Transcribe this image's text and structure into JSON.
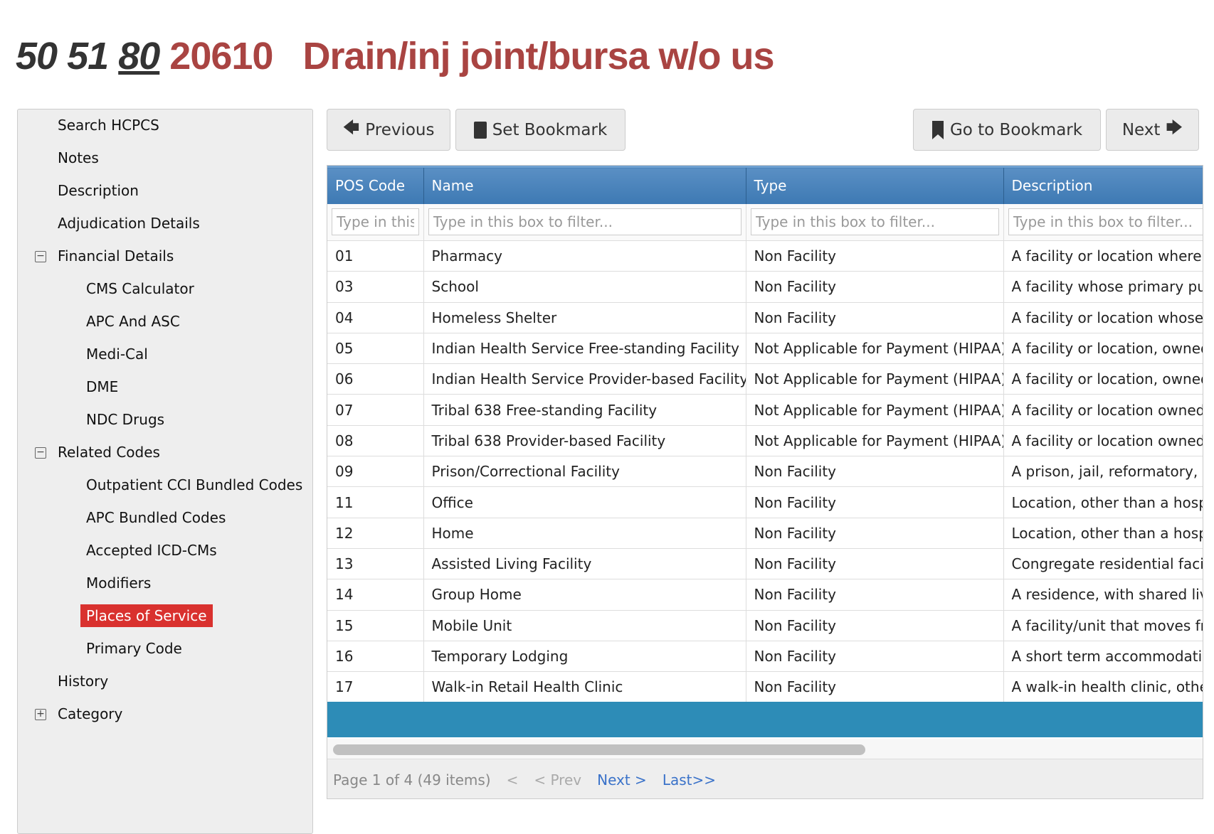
{
  "header": {
    "modifiers": [
      "50",
      "51"
    ],
    "modifier_underlined": "80",
    "code": "20610",
    "title": "Drain/inj joint/bursa w/o us"
  },
  "sidebar": {
    "items": [
      {
        "label": "Search HCPCS",
        "level": 1
      },
      {
        "label": "Notes",
        "level": 1
      },
      {
        "label": "Description",
        "level": 1
      },
      {
        "label": "Adjudication Details",
        "level": 1
      },
      {
        "label": "Financial Details",
        "level": 1,
        "toggle": "collapse"
      },
      {
        "label": "CMS Calculator",
        "level": 2
      },
      {
        "label": "APC And ASC",
        "level": 2
      },
      {
        "label": "Medi-Cal",
        "level": 2
      },
      {
        "label": "DME",
        "level": 2
      },
      {
        "label": "NDC Drugs",
        "level": 2
      },
      {
        "label": "Related Codes",
        "level": 1,
        "toggle": "collapse"
      },
      {
        "label": "Outpatient CCI Bundled Codes",
        "level": 2
      },
      {
        "label": "APC Bundled Codes",
        "level": 2
      },
      {
        "label": "Accepted ICD-CMs",
        "level": 2
      },
      {
        "label": "Modifiers",
        "level": 2
      },
      {
        "label": "Places of Service",
        "level": 2,
        "active": true
      },
      {
        "label": "Primary Code",
        "level": 2
      },
      {
        "label": "History",
        "level": 1
      },
      {
        "label": "Category",
        "level": 1,
        "toggle": "expand"
      }
    ]
  },
  "toolbar": {
    "previous": "Previous",
    "set_bookmark": "Set Bookmark",
    "go_to_bookmark": "Go to Bookmark",
    "next": "Next"
  },
  "table": {
    "columns": [
      "POS Code",
      "Name",
      "Type",
      "Description"
    ],
    "filter_placeholder": "Type in this box to filter...",
    "rows": [
      [
        "01",
        "Pharmacy",
        "Non Facility",
        "A facility or location where d"
      ],
      [
        "03",
        "School",
        "Non Facility",
        "A facility whose primary purp"
      ],
      [
        "04",
        "Homeless Shelter",
        "Non Facility",
        "A facility or location whose p"
      ],
      [
        "05",
        "Indian Health Service Free-standing Facility",
        "Not Applicable for Payment (HIPAA)",
        "A facility or location, owned"
      ],
      [
        "06",
        "Indian Health Service Provider-based Facility",
        "Not Applicable for Payment (HIPAA)",
        "A facility or location, owned"
      ],
      [
        "07",
        "Tribal 638 Free-standing Facility",
        "Not Applicable for Payment (HIPAA)",
        "A facility or location owned a"
      ],
      [
        "08",
        "Tribal 638 Provider-based Facility",
        "Not Applicable for Payment (HIPAA)",
        "A facility or location owned a"
      ],
      [
        "09",
        "Prison/Correctional Facility",
        "Non Facility",
        "A prison, jail, reformatory, w"
      ],
      [
        "11",
        "Office",
        "Non Facility",
        "Location, other than a hospi"
      ],
      [
        "12",
        "Home",
        "Non Facility",
        "Location, other than a hospi"
      ],
      [
        "13",
        "Assisted Living Facility",
        "Non Facility",
        "Congregate residential facilit"
      ],
      [
        "14",
        "Group Home",
        "Non Facility",
        "A residence, with shared livi"
      ],
      [
        "15",
        "Mobile Unit",
        "Non Facility",
        "A facility/unit that moves fro"
      ],
      [
        "16",
        "Temporary Lodging",
        "Non Facility",
        "A short term accommodation"
      ],
      [
        "17",
        "Walk-in Retail Health Clinic",
        "Non Facility",
        "A walk-in health clinic, other"
      ]
    ]
  },
  "pager": {
    "info": "Page 1 of 4 (49 items)",
    "first": "<",
    "prev": "< Prev",
    "next": "Next >",
    "last": "Last>>"
  },
  "colors": {
    "accent_red": "#a94442",
    "active_item": "#d9312e",
    "header_blue": "#3d79b3",
    "bar_blue": "#2d8cb7",
    "link": "#3a72c9"
  }
}
